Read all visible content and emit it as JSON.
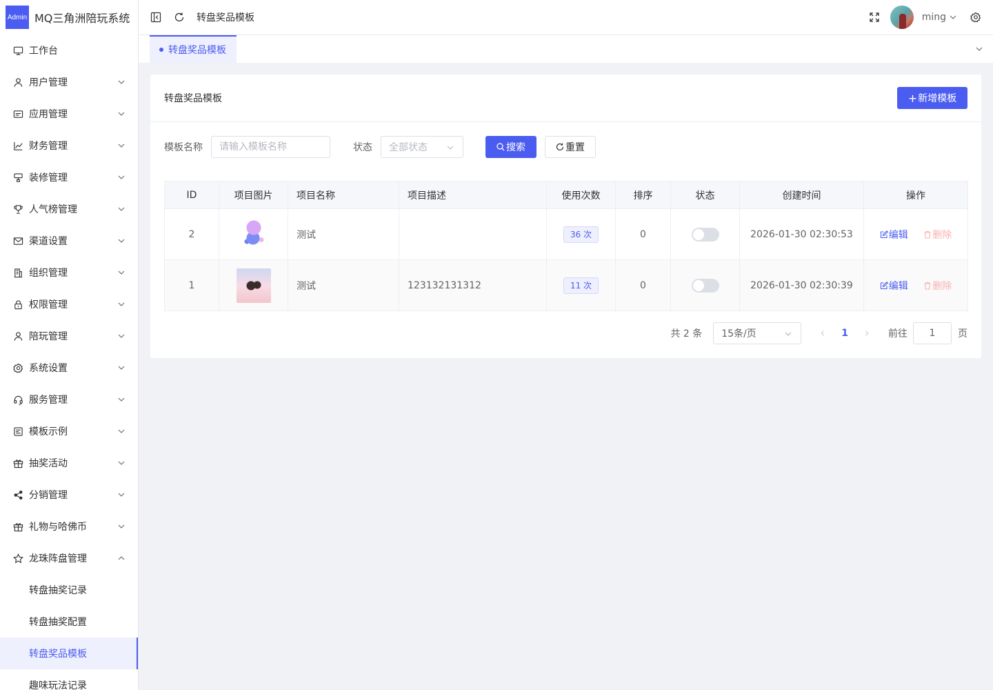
{
  "app": {
    "logo_badge": "Admin",
    "title": "MQ三角洲陪玩系统"
  },
  "sidebar": {
    "items": [
      {
        "label": "工作台",
        "icon": "monitor-icon",
        "has_arrow": false
      },
      {
        "label": "用户管理",
        "icon": "user-icon",
        "has_arrow": true
      },
      {
        "label": "应用管理",
        "icon": "app-window-icon",
        "has_arrow": true
      },
      {
        "label": "财务管理",
        "icon": "chart-icon",
        "has_arrow": true
      },
      {
        "label": "装修管理",
        "icon": "decoration-icon",
        "has_arrow": true
      },
      {
        "label": "人气榜管理",
        "icon": "trophy-icon",
        "has_arrow": true
      },
      {
        "label": "渠道设置",
        "icon": "mail-icon",
        "has_arrow": true
      },
      {
        "label": "组织管理",
        "icon": "building-icon",
        "has_arrow": true
      },
      {
        "label": "权限管理",
        "icon": "lock-icon",
        "has_arrow": true
      },
      {
        "label": "陪玩管理",
        "icon": "user-icon",
        "has_arrow": true
      },
      {
        "label": "系统设置",
        "icon": "gear-icon",
        "has_arrow": true
      },
      {
        "label": "服务管理",
        "icon": "headset-icon",
        "has_arrow": true
      },
      {
        "label": "模板示例",
        "icon": "template-icon",
        "has_arrow": true
      },
      {
        "label": "抽奖活动",
        "icon": "gift-icon",
        "has_arrow": true
      },
      {
        "label": "分销管理",
        "icon": "share-icon",
        "has_arrow": true
      },
      {
        "label": "礼物与哈佛币",
        "icon": "gift-icon",
        "has_arrow": true
      },
      {
        "label": "龙珠阵盘管理",
        "icon": "star-icon",
        "has_arrow": true,
        "expanded": true
      }
    ],
    "submenu": [
      {
        "label": "转盘抽奖记录",
        "active": false
      },
      {
        "label": "转盘抽奖配置",
        "active": false
      },
      {
        "label": "转盘奖品模板",
        "active": true
      },
      {
        "label": "趣味玩法记录",
        "active": false
      }
    ]
  },
  "header": {
    "breadcrumb": "转盘奖品模板",
    "username": "ming"
  },
  "tags": {
    "active_tag": "转盘奖品模板"
  },
  "card": {
    "title": "转盘奖品模板",
    "add_button": "新增模板"
  },
  "filter": {
    "name_label": "模板名称",
    "name_placeholder": "请输入模板名称",
    "status_label": "状态",
    "status_value": "全部状态",
    "search_button": "搜索",
    "reset_button": "重置"
  },
  "table": {
    "columns": [
      "ID",
      "项目图片",
      "项目名称",
      "项目描述",
      "使用次数",
      "排序",
      "状态",
      "创建时间",
      "操作"
    ],
    "rows": [
      {
        "id": "2",
        "name": "测试",
        "description": "",
        "usage": "36 次",
        "sort": "0",
        "status_on": false,
        "created": "2026-01-30 02:30:53",
        "edit": "编辑",
        "delete": "删除"
      },
      {
        "id": "1",
        "name": "测试",
        "description": "123132131312",
        "usage": "11 次",
        "sort": "0",
        "status_on": false,
        "created": "2026-01-30 02:30:39",
        "edit": "编辑",
        "delete": "删除"
      }
    ]
  },
  "pagination": {
    "total": "共 2 条",
    "page_size": "15条/页",
    "current_page": "1",
    "goto_label": "前往",
    "goto_value": "1",
    "page_suffix": "页"
  },
  "colors": {
    "primary": "#4b5cf0",
    "danger_light": "#f9b0b0"
  }
}
